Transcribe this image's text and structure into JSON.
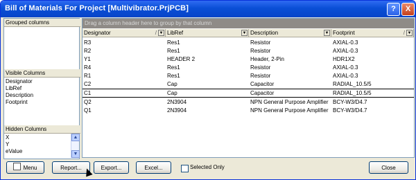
{
  "window": {
    "title": "Bill of Materials For Project [Multivibrator.PrjPCB]",
    "help_icon": "?",
    "close_icon": "X"
  },
  "left": {
    "grouped_header": "Grouped columns",
    "visible_header": "Visible Columns",
    "visible_items": [
      "Designator",
      "LibRef",
      "Description",
      "Footprint"
    ],
    "hidden_header": "Hidden Columns",
    "hidden_items": [
      "X",
      "Y",
      "eValue"
    ]
  },
  "grid": {
    "group_hint": "Drag a column header here to group by that column",
    "columns": [
      "Designator",
      "LibRef",
      "Description",
      "Footprint"
    ],
    "rows": [
      [
        "R3",
        "Res1",
        "Resistor",
        "AXIAL-0.3"
      ],
      [
        "R2",
        "Res1",
        "Resistor",
        "AXIAL-0.3"
      ],
      [
        "Y1",
        "HEADER 2",
        "Header, 2-Pin",
        "HDR1X2"
      ],
      [
        "R4",
        "Res1",
        "Resistor",
        "AXIAL-0.3"
      ],
      [
        "R1",
        "Res1",
        "Resistor",
        "AXIAL-0.3"
      ],
      [
        "C2",
        "Cap",
        "Capacitor",
        "RADIAL_10.5/5"
      ],
      [
        "C1",
        "Cap",
        "Capacitor",
        "RADIAL_10.5/5"
      ],
      [
        "Q2",
        "2N3904",
        "NPN General Purpose Amplifier",
        "BCY-W3/D4.7"
      ],
      [
        "Q1",
        "2N3904",
        "NPN General Purpose Amplifier",
        "BCY-W3/D4.7"
      ]
    ]
  },
  "bottom": {
    "menu_label": "Menu",
    "report_label": "Report...",
    "export_label": "Export...",
    "excel_label": "Excel...",
    "selected_only_label": "Selected Only",
    "close_label": "Close"
  }
}
